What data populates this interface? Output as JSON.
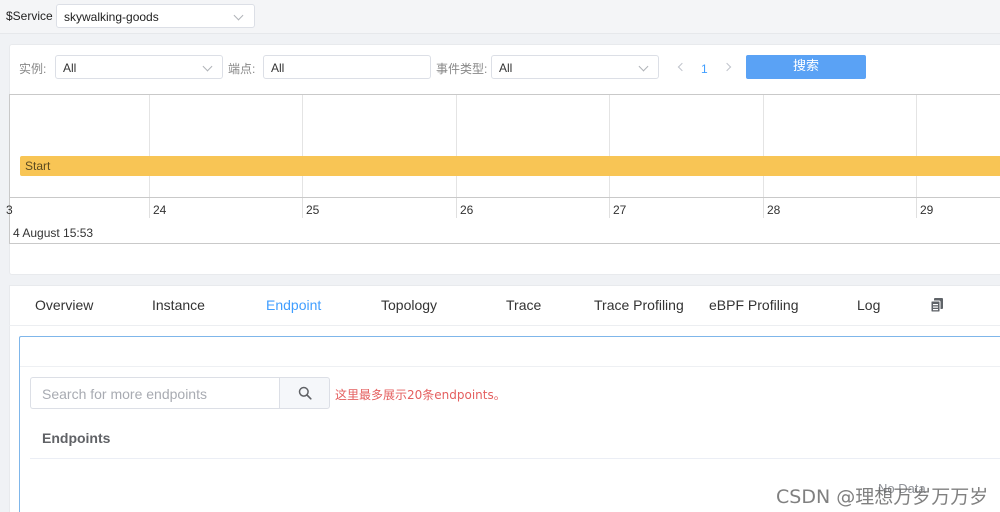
{
  "topbar": {
    "service_label": "$Service",
    "service_value": "skywalking-goods"
  },
  "filters": {
    "instance_label": "实例:",
    "instance_value": "All",
    "endpoint_label": "端点:",
    "endpoint_value": "All",
    "event_type_label": "事件类型:",
    "event_type_value": "All",
    "page": "1",
    "search_label": "搜索"
  },
  "timeline": {
    "bar_label": "Start",
    "bar_color": "#f8c555",
    "dates": [
      "3",
      "24",
      "25",
      "26",
      "27",
      "28",
      "29"
    ],
    "major_label": "4 August 15:53"
  },
  "tabs": [
    {
      "label": "Overview",
      "active": false
    },
    {
      "label": "Instance",
      "active": false
    },
    {
      "label": "Endpoint",
      "active": true
    },
    {
      "label": "Topology",
      "active": false
    },
    {
      "label": "Trace",
      "active": false
    },
    {
      "label": "Trace Profiling",
      "active": false
    },
    {
      "label": "eBPF Profiling",
      "active": false
    },
    {
      "label": "Log",
      "active": false
    }
  ],
  "endpoint_panel": {
    "search_placeholder": "Search for more endpoints",
    "hint": "这里最多展示20条endpoints。",
    "title": "Endpoints",
    "no_data": "No Data"
  },
  "watermark": "CSDN @理想万岁万万岁",
  "colors": {
    "accent": "#409eff",
    "search_button": "#5aa2f5",
    "hint_text": "#e45f5f"
  }
}
